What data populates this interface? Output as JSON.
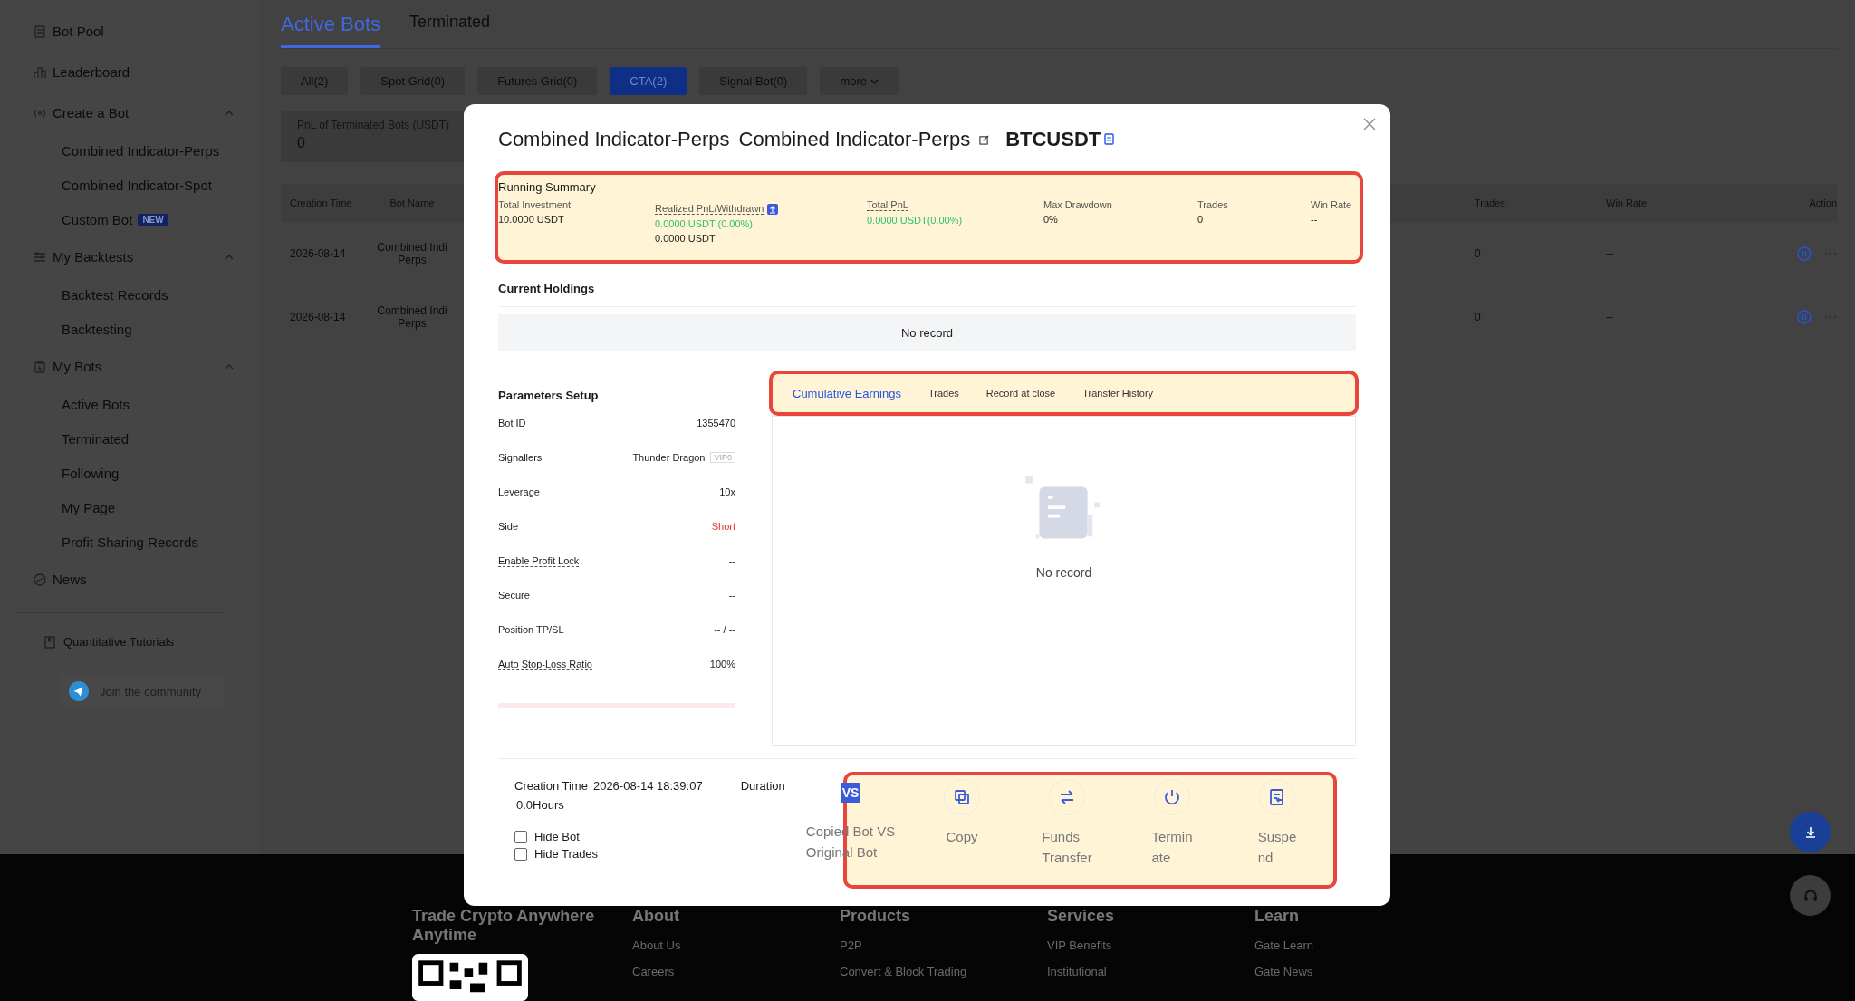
{
  "sidebar": {
    "items": [
      {
        "label": "Bot Pool"
      },
      {
        "label": "Leaderboard"
      },
      {
        "label": "Create a Bot",
        "expanded": true,
        "children": [
          {
            "label": "Combined Indicator-Perps"
          },
          {
            "label": "Combined Indicator-Spot"
          },
          {
            "label": "Custom Bot",
            "badge": "NEW"
          }
        ]
      },
      {
        "label": "My Backtests",
        "expanded": true,
        "children": [
          {
            "label": "Backtest Records"
          },
          {
            "label": "Backtesting"
          }
        ]
      },
      {
        "label": "My Bots",
        "expanded": true,
        "children": [
          {
            "label": "Active Bots"
          },
          {
            "label": "Terminated"
          },
          {
            "label": "Following"
          },
          {
            "label": "My Page"
          },
          {
            "label": "Profit Sharing Records"
          }
        ]
      },
      {
        "label": "News"
      }
    ],
    "tutorials": "Quantitative Tutorials",
    "community": "Join the community"
  },
  "main": {
    "tabs": [
      {
        "label": "Active Bots",
        "selected": true
      },
      {
        "label": "Terminated",
        "selected": false
      }
    ],
    "filters": [
      {
        "label": "All(2)",
        "selected": false,
        "kind": "chip"
      },
      {
        "label": "Spot Grid(0)",
        "selected": false,
        "kind": "chip"
      },
      {
        "label": "Futures Grid(0)",
        "selected": false,
        "kind": "chip"
      },
      {
        "label": "CTA(2)",
        "selected": true,
        "kind": "chip"
      },
      {
        "label": "Signal Bot(0)",
        "selected": false,
        "kind": "chip"
      },
      {
        "label": "more",
        "selected": false,
        "kind": "dropdown"
      }
    ],
    "summary_card": {
      "label": "PnL of Terminated Bots (USDT)",
      "value": "0"
    },
    "table": {
      "columns": [
        "Creation Time",
        "Bot Name",
        "Trades",
        "Win Rate",
        "Action"
      ],
      "rows": [
        {
          "creation_time": "2026-08-14",
          "bot_name": [
            "Combined Indi",
            "Perps"
          ],
          "trades": "0",
          "win_rate": "--"
        },
        {
          "creation_time": "2026-08-14",
          "bot_name": [
            "Combined Indi",
            "Perps"
          ],
          "trades": "0",
          "win_rate": "--"
        }
      ]
    }
  },
  "modal": {
    "title": {
      "type": "Combined Indicator-Perps",
      "name": "Combined Indicator-Perps",
      "symbol": "BTCUSDT"
    },
    "running_summary": {
      "title": "Running Summary",
      "highlighted": true,
      "metrics": [
        {
          "label": "Total Investment",
          "underlined": false,
          "values": [
            {
              "text": "10.0000 USDT"
            }
          ]
        },
        {
          "label": "Realized PnL/Withdrawn",
          "underlined": true,
          "info": true,
          "values": [
            {
              "text": "0.0000 USDT (0.00%)",
              "color": "#2fbf71"
            },
            {
              "text": "0.0000 USDT"
            }
          ]
        },
        {
          "label": "Total PnL",
          "underlined": true,
          "values": [
            {
              "text": "0.0000 USDT(0.00%)",
              "color": "#2fbf71"
            }
          ]
        },
        {
          "label": "Max Drawdown",
          "underlined": false,
          "values": [
            {
              "text": "0%"
            }
          ]
        },
        {
          "label": "Trades",
          "underlined": false,
          "values": [
            {
              "text": "0"
            }
          ]
        },
        {
          "label": "Win Rate",
          "underlined": false,
          "values": [
            {
              "text": "--"
            }
          ]
        }
      ]
    },
    "holdings": {
      "title": "Current Holdings",
      "empty_text": "No record"
    },
    "parameters": {
      "title": "Parameters Setup",
      "rows": [
        {
          "label": "Bot ID",
          "value": "1355470",
          "underlined": false
        },
        {
          "label": "Signallers",
          "value": "Thunder Dragon",
          "badge": "VIP0",
          "underlined": false
        },
        {
          "label": "Leverage",
          "value": "10x",
          "underlined": false
        },
        {
          "label": "Side",
          "value": "Short",
          "color": "#e5281e",
          "underlined": false
        },
        {
          "label": "Enable Profit Lock",
          "value": "--",
          "underlined": true
        },
        {
          "label": "Secure",
          "value": "--",
          "underlined": false
        },
        {
          "label": "Position TP/SL",
          "value": "-- / --",
          "underlined": false
        },
        {
          "label": "Auto Stop-Loss Ratio",
          "value": "100%",
          "underlined": true
        }
      ]
    },
    "records": {
      "highlighted": true,
      "tabs": [
        {
          "label": "Cumulative Earnings",
          "selected": true
        },
        {
          "label": "Trades",
          "selected": false
        },
        {
          "label": "Record at close",
          "selected": false
        },
        {
          "label": "Transfer History",
          "selected": false
        }
      ],
      "empty_text": "No record"
    },
    "info": {
      "creation_label": "Creation Time",
      "creation_value": "2026-08-14 18:39:07",
      "duration_label": "Duration",
      "duration_value": "0.0Hours",
      "checkboxes": [
        {
          "label": "Hide Bot",
          "checked": false
        },
        {
          "label": "Hide Trades",
          "checked": false
        }
      ]
    },
    "actions": {
      "highlighted": true,
      "items": [
        {
          "lines": [
            "Copied Bot VS",
            "Original Bot"
          ],
          "icon_text": "VS"
        },
        {
          "lines": [
            "Copy"
          ]
        },
        {
          "lines": [
            "Funds",
            "Transfer"
          ]
        },
        {
          "lines": [
            "Termin",
            "ate"
          ]
        },
        {
          "lines": [
            "Suspe",
            "nd"
          ]
        }
      ]
    }
  },
  "footer": {
    "tagline": "Trade Crypto Anywhere Anytime",
    "columns": [
      {
        "heading": "About",
        "links": [
          "About Us",
          "Careers"
        ]
      },
      {
        "heading": "Products",
        "links": [
          "P2P",
          "Convert & Block Trading"
        ]
      },
      {
        "heading": "Services",
        "links": [
          "VIP Benefits",
          "Institutional"
        ]
      },
      {
        "heading": "Learn",
        "links": [
          "Gate Learn",
          "Gate News"
        ]
      }
    ]
  }
}
